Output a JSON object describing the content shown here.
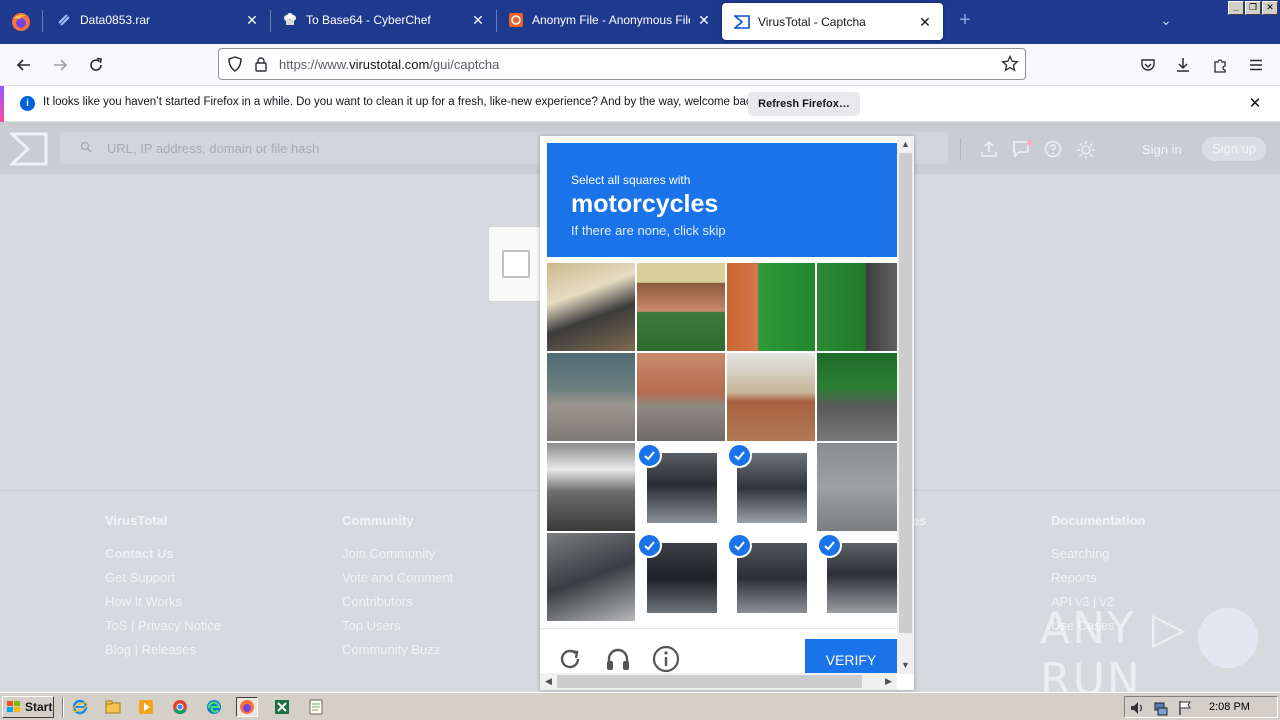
{
  "browser": {
    "tabs": [
      {
        "label": "Data0853.rar",
        "icon": "link-icon"
      },
      {
        "label": "To Base64 - CyberChef",
        "icon": "chef-hat-icon"
      },
      {
        "label": "Anonym File - Anonymous File Uplo",
        "icon": "anonym-file-icon"
      },
      {
        "label": "VirusTotal - Captcha",
        "icon": "virustotal-icon",
        "active": true
      }
    ],
    "url_prefix": "https://www.",
    "url_host": "virustotal.com",
    "url_path": "/gui/captcha"
  },
  "notification": {
    "message": "It looks like you haven’t started Firefox in a while. Do you want to clean it up for a fresh, like-new experience? And by the way, welcome back!",
    "button": "Refresh Firefox…"
  },
  "vt": {
    "search_placeholder": "URL, IP address, domain or file hash",
    "sign_in": "Sign in",
    "sign_up": "Sign up"
  },
  "footer": {
    "columns": [
      {
        "heading": "VirusTotal",
        "links": [
          "Contact Us",
          "Get Support",
          "How It Works",
          "ToS | Privacy Notice",
          "Blog | Releases"
        ]
      },
      {
        "heading": "Community",
        "links": [
          "Join Community",
          "Vote and Comment",
          "Contributors",
          "Top Users",
          "Community Buzz"
        ]
      },
      {
        "heading": "es",
        "links": []
      },
      {
        "heading": "Documentation",
        "links": [
          "Searching",
          "Reports",
          "API v3 | v2",
          "Use Cases"
        ]
      }
    ],
    "watermark": "ANY ▷ RUN"
  },
  "captcha": {
    "prompt_line1": "Select all squares with",
    "target": "motorcycles",
    "hint": "If there are none, click skip",
    "verify": "VERIFY",
    "selected_tiles": [
      9,
      10,
      13,
      14,
      15
    ]
  },
  "taskbar": {
    "start": "Start",
    "clock": "2:08 PM"
  },
  "colors": {
    "tabstrip": "#1e3a8f",
    "captcha_blue": "#1a73e8"
  }
}
